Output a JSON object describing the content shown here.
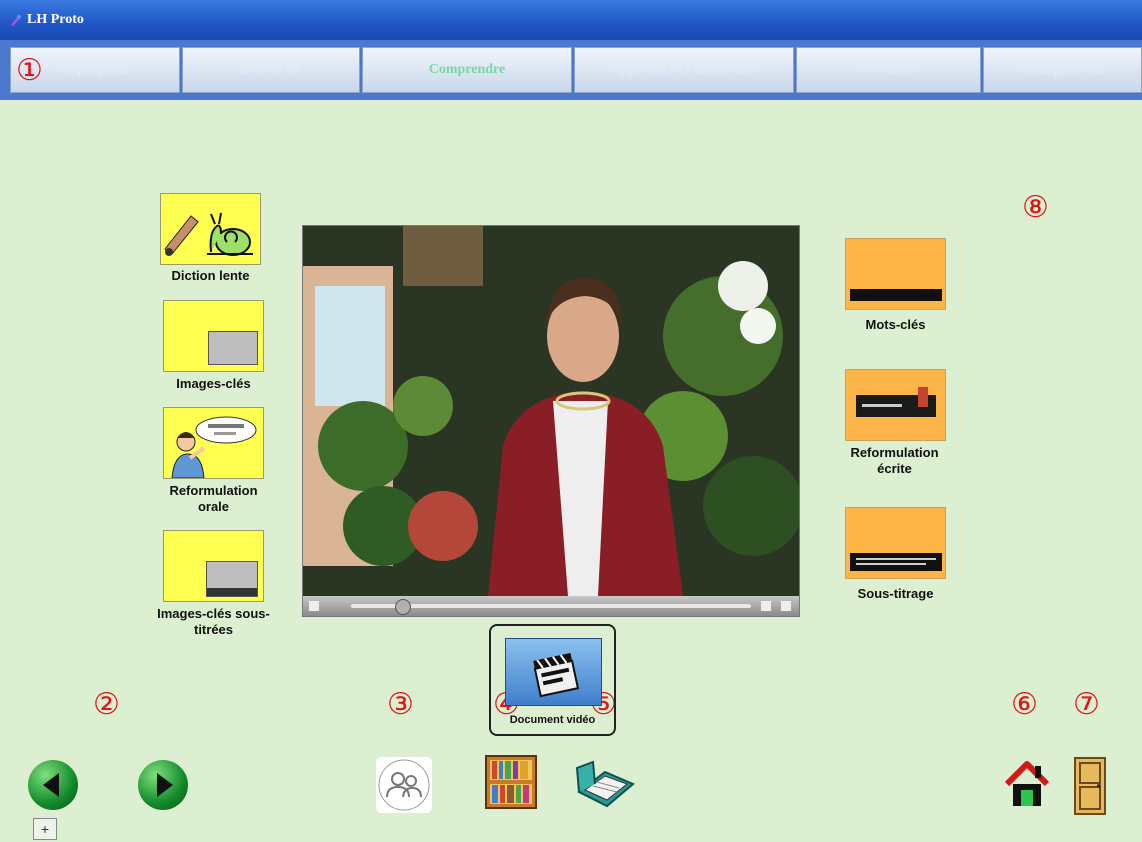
{
  "window": {
    "title": "LH Proto"
  },
  "tabs": [
    {
      "label": "Se préparer",
      "active": false
    },
    {
      "label": "Découvrir",
      "active": false
    },
    {
      "label": "Comprendre",
      "active": true
    },
    {
      "label": "Apprendre et mémoriser",
      "active": false
    },
    {
      "label": "S'évaluer",
      "active": false
    },
    {
      "label": "Aller plus loin",
      "active": false
    }
  ],
  "markers": [
    "①",
    "②",
    "③",
    "④",
    "⑤",
    "⑥",
    "⑦",
    "⑧"
  ],
  "left_tools": [
    {
      "label": "Diction lente",
      "icon": "snail-icon"
    },
    {
      "label": "Images-clés",
      "icon": "key-images-icon"
    },
    {
      "label": "Reformulation orale",
      "icon": "speaking-person-icon"
    },
    {
      "label": "Images-clés sous-titrées",
      "icon": "subtitled-images-icon"
    }
  ],
  "right_tools": [
    {
      "label": "Mots-clés",
      "icon": "keywords-icon"
    },
    {
      "label": "Reformulation écrite",
      "icon": "written-rephrasing-icon"
    },
    {
      "label": "Sous-titrage",
      "icon": "subtitles-icon"
    }
  ],
  "video_doc": {
    "label": "Document vidéo",
    "icon": "clapperboard-icon"
  },
  "bottom_tools": [
    "people-icon",
    "bookshelf-icon",
    "notebook-icon"
  ],
  "nav": {
    "back_icon": "arrow-left-icon",
    "forward_icon": "arrow-right-icon",
    "home_icon": "home-icon",
    "exit_icon": "door-icon",
    "zoom_label": "+"
  },
  "colors": {
    "titlebar": "#1f56c8",
    "tabbar": "#4a78cf",
    "background": "#dcefd0",
    "marker": "#e0141a",
    "tool_yellow": "#ffff52",
    "tool_orange": "#fdb548"
  }
}
